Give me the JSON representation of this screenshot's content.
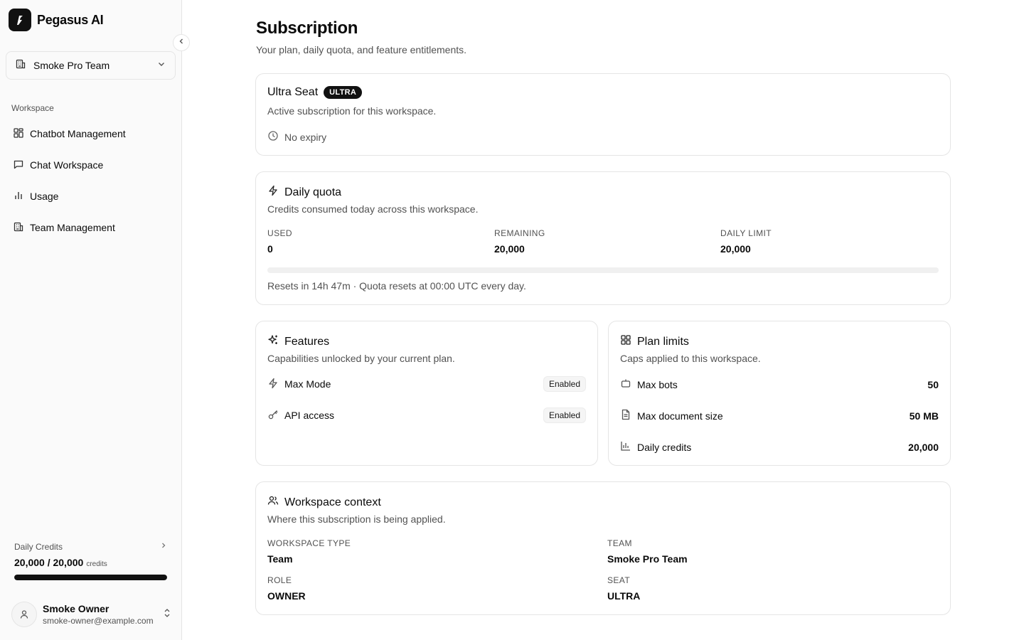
{
  "app": {
    "name": "Pegasus AI"
  },
  "sidebar": {
    "team_selector": {
      "value": "Smoke Pro Team"
    },
    "section_label": "Workspace",
    "items": [
      {
        "label": "Chatbot Management",
        "icon": "grid-icon"
      },
      {
        "label": "Chat Workspace",
        "icon": "message-icon"
      },
      {
        "label": "Usage",
        "icon": "bar-chart-icon"
      },
      {
        "label": "Team Management",
        "icon": "building-icon"
      }
    ],
    "credits": {
      "title": "Daily Credits",
      "value": "20,000 / 20,000",
      "unit": "credits",
      "fraction": 1.0
    },
    "user": {
      "name": "Smoke Owner",
      "email": "smoke-owner@example.com"
    }
  },
  "page": {
    "title": "Subscription",
    "subtitle": "Your plan, daily quota, and feature entitlements."
  },
  "plan_card": {
    "title": "Ultra Seat",
    "badge": "ULTRA",
    "description": "Active subscription for this workspace.",
    "expiry": "No expiry"
  },
  "quota_card": {
    "title": "Daily quota",
    "description": "Credits consumed today across this workspace.",
    "used_label": "USED",
    "used_value": "0",
    "remaining_label": "REMAINING",
    "remaining_value": "20,000",
    "limit_label": "DAILY LIMIT",
    "limit_value": "20,000",
    "used_fraction": 0.0,
    "note": "Resets in 14h 47m · Quota resets at 00:00 UTC every day."
  },
  "features_card": {
    "title": "Features",
    "description": "Capabilities unlocked by your current plan.",
    "items": [
      {
        "name": "Max Mode",
        "status": "Enabled",
        "icon": "zap-icon"
      },
      {
        "name": "API access",
        "status": "Enabled",
        "icon": "key-icon"
      }
    ]
  },
  "limits_card": {
    "title": "Plan limits",
    "description": "Caps applied to this workspace.",
    "items": [
      {
        "name": "Max bots",
        "value": "50",
        "icon": "bot-icon"
      },
      {
        "name": "Max document size",
        "value": "50 MB",
        "icon": "file-icon"
      },
      {
        "name": "Daily credits",
        "value": "20,000",
        "icon": "bar-chart-icon"
      }
    ]
  },
  "context_card": {
    "title": "Workspace context",
    "description": "Where this subscription is being applied.",
    "fields": {
      "workspace_type": {
        "label": "WORKSPACE TYPE",
        "value": "Team"
      },
      "team": {
        "label": "TEAM",
        "value": "Smoke Pro Team"
      },
      "role": {
        "label": "ROLE",
        "value": "OWNER"
      },
      "seat": {
        "label": "SEAT",
        "value": "ULTRA"
      }
    }
  }
}
